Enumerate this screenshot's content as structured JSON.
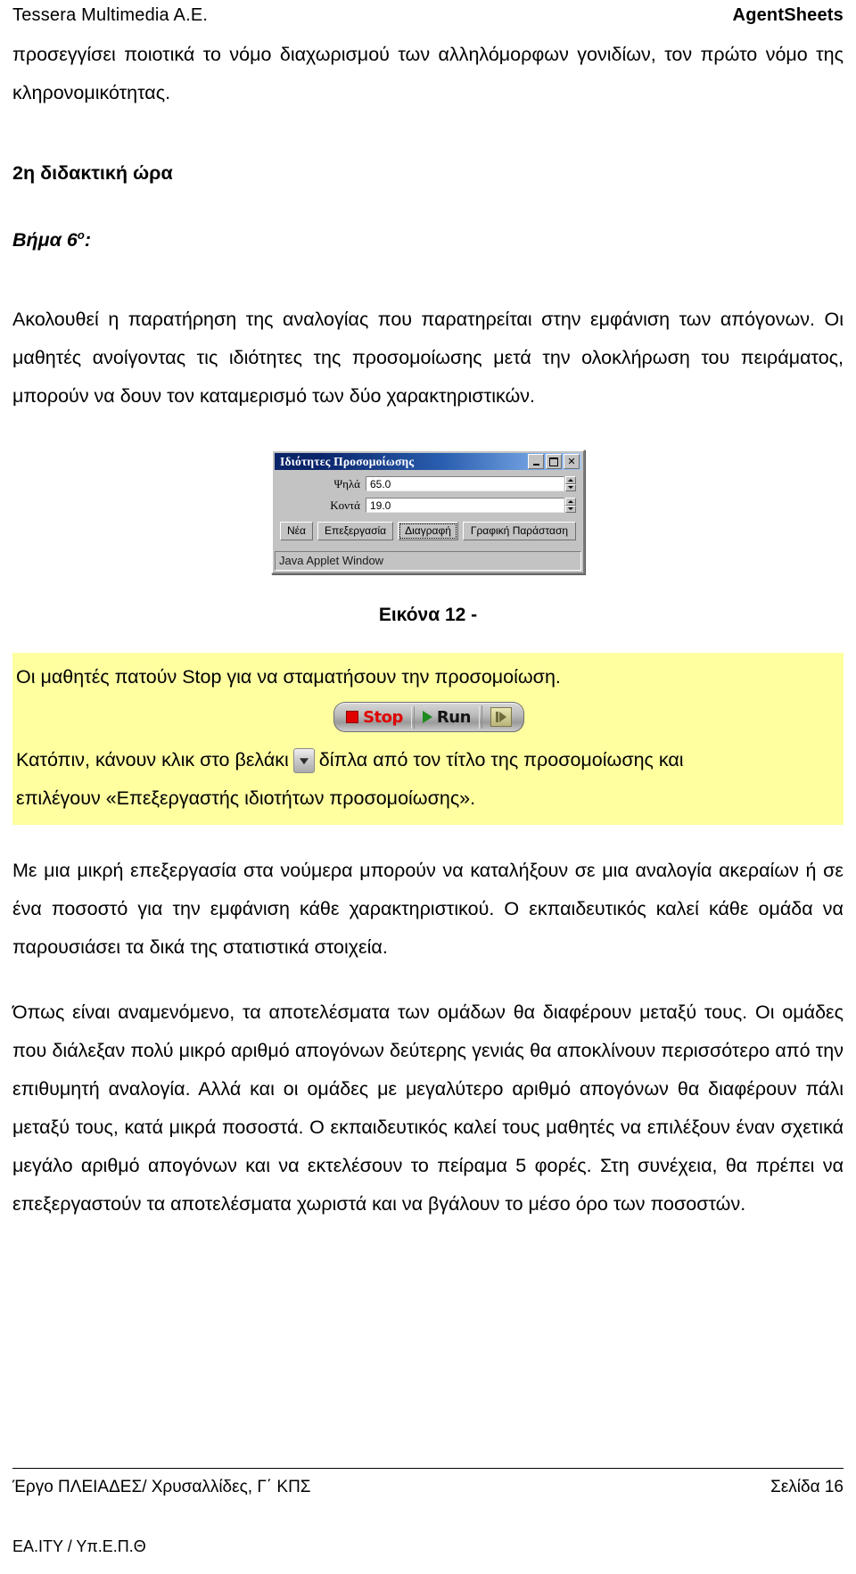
{
  "header": {
    "left": "Tessera Multimedia A.E.",
    "right": "AgentSheets"
  },
  "content": {
    "para_top": "προσεγγίσει ποιοτικά το νόμο διαχωρισμού των αλληλόμορφων γονιδίων, τον πρώτο νόμο της κληρονομικότητας.",
    "lesson_heading": "2η διδακτική ώρα",
    "step_heading_text": "Βήμα 6",
    "step_heading_sup": "ο",
    "step_heading_colon": ":",
    "para_step": "Ακολουθεί η παρατήρηση της αναλογίας που παρατηρείται στην εμφάνιση των απόγονων. Οι μαθητές ανοίγοντας τις ιδιότητες της προσομοίωσης μετά την ολοκλήρωση του πειράματος, μπορούν να δουν τον καταμερισμό των δύο χαρακτηριστικών.",
    "figure_caption": "Εικόνα 12 -",
    "para_after_1": "Με μια μικρή επεξεργασία στα νούμερα μπορούν να καταλήξουν σε μια αναλογία ακεραίων ή σε ένα ποσοστό για την εμφάνιση κάθε χαρακτηριστικού. Ο εκπαιδευτικός καλεί κάθε ομάδα να παρουσιάσει τα δικά της στατιστικά στοιχεία.",
    "para_after_2": "Όπως είναι αναμενόμενο, τα αποτελέσματα των ομάδων θα διαφέρουν μεταξύ τους. Οι ομάδες που διάλεξαν πολύ μικρό αριθμό απογόνων δεύτερης γενιάς θα αποκλίνουν περισσότερο από την επιθυμητή αναλογία. Αλλά και οι ομάδες με μεγαλύτερο αριθμό απογόνων θα διαφέρουν πάλι μεταξύ τους, κατά μικρά ποσοστά. Ο εκπαιδευτικός καλεί τους μαθητές να επιλέξουν έναν σχετικά μεγάλο αριθμό απογόνων και να εκτελέσουν το πείραμα 5 φορές. Στη συνέχεια, θα πρέπει να επεξεργαστούν τα αποτελέσματα χωριστά και να βγάλουν το μέσο όρο των ποσοστών."
  },
  "highlight": {
    "line1": "Οι μαθητές πατούν Stop για να σταματήσουν την προσομοίωση.",
    "line2_pre": "Κατόπιν, κάνουν κλικ στο βελάκι",
    "line2_post": "δίπλα από τον τίτλο της προσομοίωσης και",
    "line3": "επιλέγουν «Επεξεργαστής ιδιοτήτων προσομοίωσης».",
    "background_color": "#ffffa0"
  },
  "toolbar": {
    "stop_label": "Stop",
    "run_label": "Run",
    "stop_color": "#e00000",
    "run_color": "#1f8a1f",
    "step_icon_name": "step-forward-icon"
  },
  "dialog": {
    "title": "Ιδιότητες Προσομοίωσης",
    "window_buttons": [
      {
        "name": "minimize-button",
        "glyph": "_"
      },
      {
        "name": "maximize-button",
        "glyph": "□"
      },
      {
        "name": "close-button",
        "glyph": "✕"
      }
    ],
    "fields": [
      {
        "label": "Ψηλά",
        "value": "65.0"
      },
      {
        "label": "Κοντά",
        "value": "19.0"
      }
    ],
    "buttons": [
      {
        "label": "Νέα",
        "focused": false
      },
      {
        "label": "Επεξεργασία",
        "focused": false
      },
      {
        "label": "Διαγραφή",
        "focused": true
      },
      {
        "label": "Γραφική Παράσταση",
        "focused": false
      }
    ],
    "status": "Java Applet Window",
    "titlebar_color": "#0a246a"
  },
  "footer": {
    "left": "Έργο ΠΛΕΙΑΔΕΣ/ Χρυσαλλίδες, Γ΄ ΚΠΣ",
    "right": "Σελίδα 16",
    "sub": "ΕΑ.ΙΤΥ / Υπ.Ε.Π.Θ"
  }
}
